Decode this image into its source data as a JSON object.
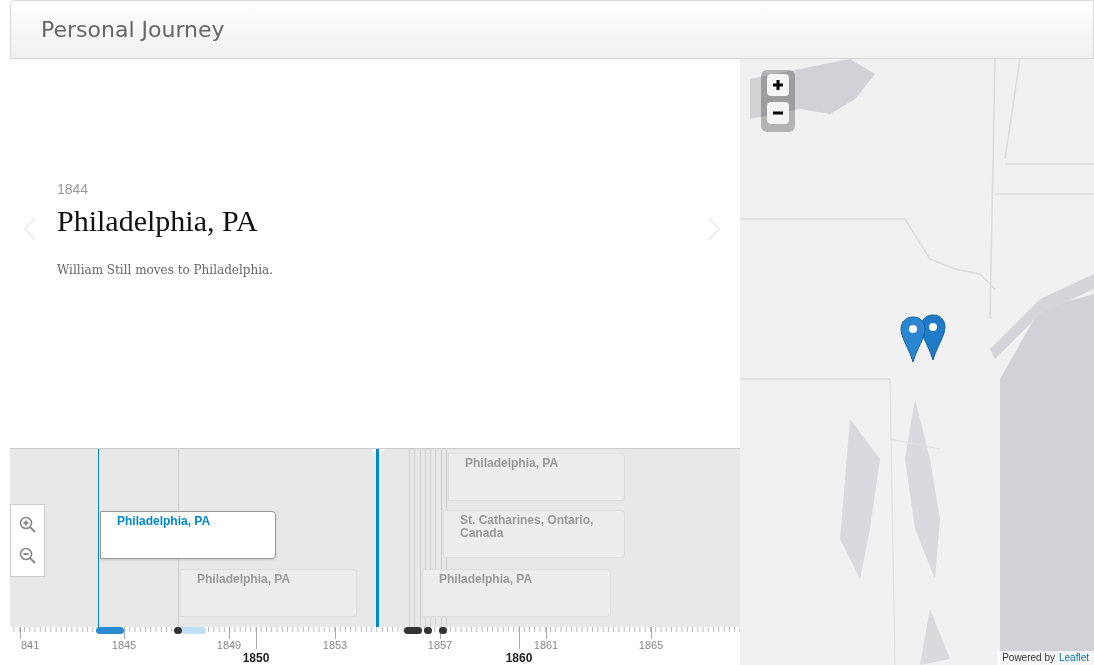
{
  "header": {
    "title": "Personal Journey"
  },
  "slide": {
    "date": "1844",
    "headline": "Philadelphia, PA",
    "text": "William Still moves to Philadelphia."
  },
  "timeline": {
    "events": [
      {
        "label": "Philadelphia, PA",
        "selected": true
      },
      {
        "label": "Philadelphia, PA",
        "selected": false
      },
      {
        "label": "Philadelphia, PA",
        "selected": false
      },
      {
        "label": "St. Catharines, Ontario, Canada",
        "selected": false
      },
      {
        "label": "Philadelphia, PA",
        "selected": false
      }
    ],
    "ticks": [
      {
        "label": "841",
        "kind": "minor"
      },
      {
        "label": "1845",
        "kind": "minor"
      },
      {
        "label": "1849",
        "kind": "minor"
      },
      {
        "label": "1850",
        "kind": "major"
      },
      {
        "label": "1853",
        "kind": "minor"
      },
      {
        "label": "1857",
        "kind": "minor"
      },
      {
        "label": "1860",
        "kind": "major"
      },
      {
        "label": "1861",
        "kind": "minor"
      },
      {
        "label": "1865",
        "kind": "minor"
      }
    ]
  },
  "map": {
    "attribution": {
      "text": "Powered by",
      "link": "Leaflet"
    }
  }
}
